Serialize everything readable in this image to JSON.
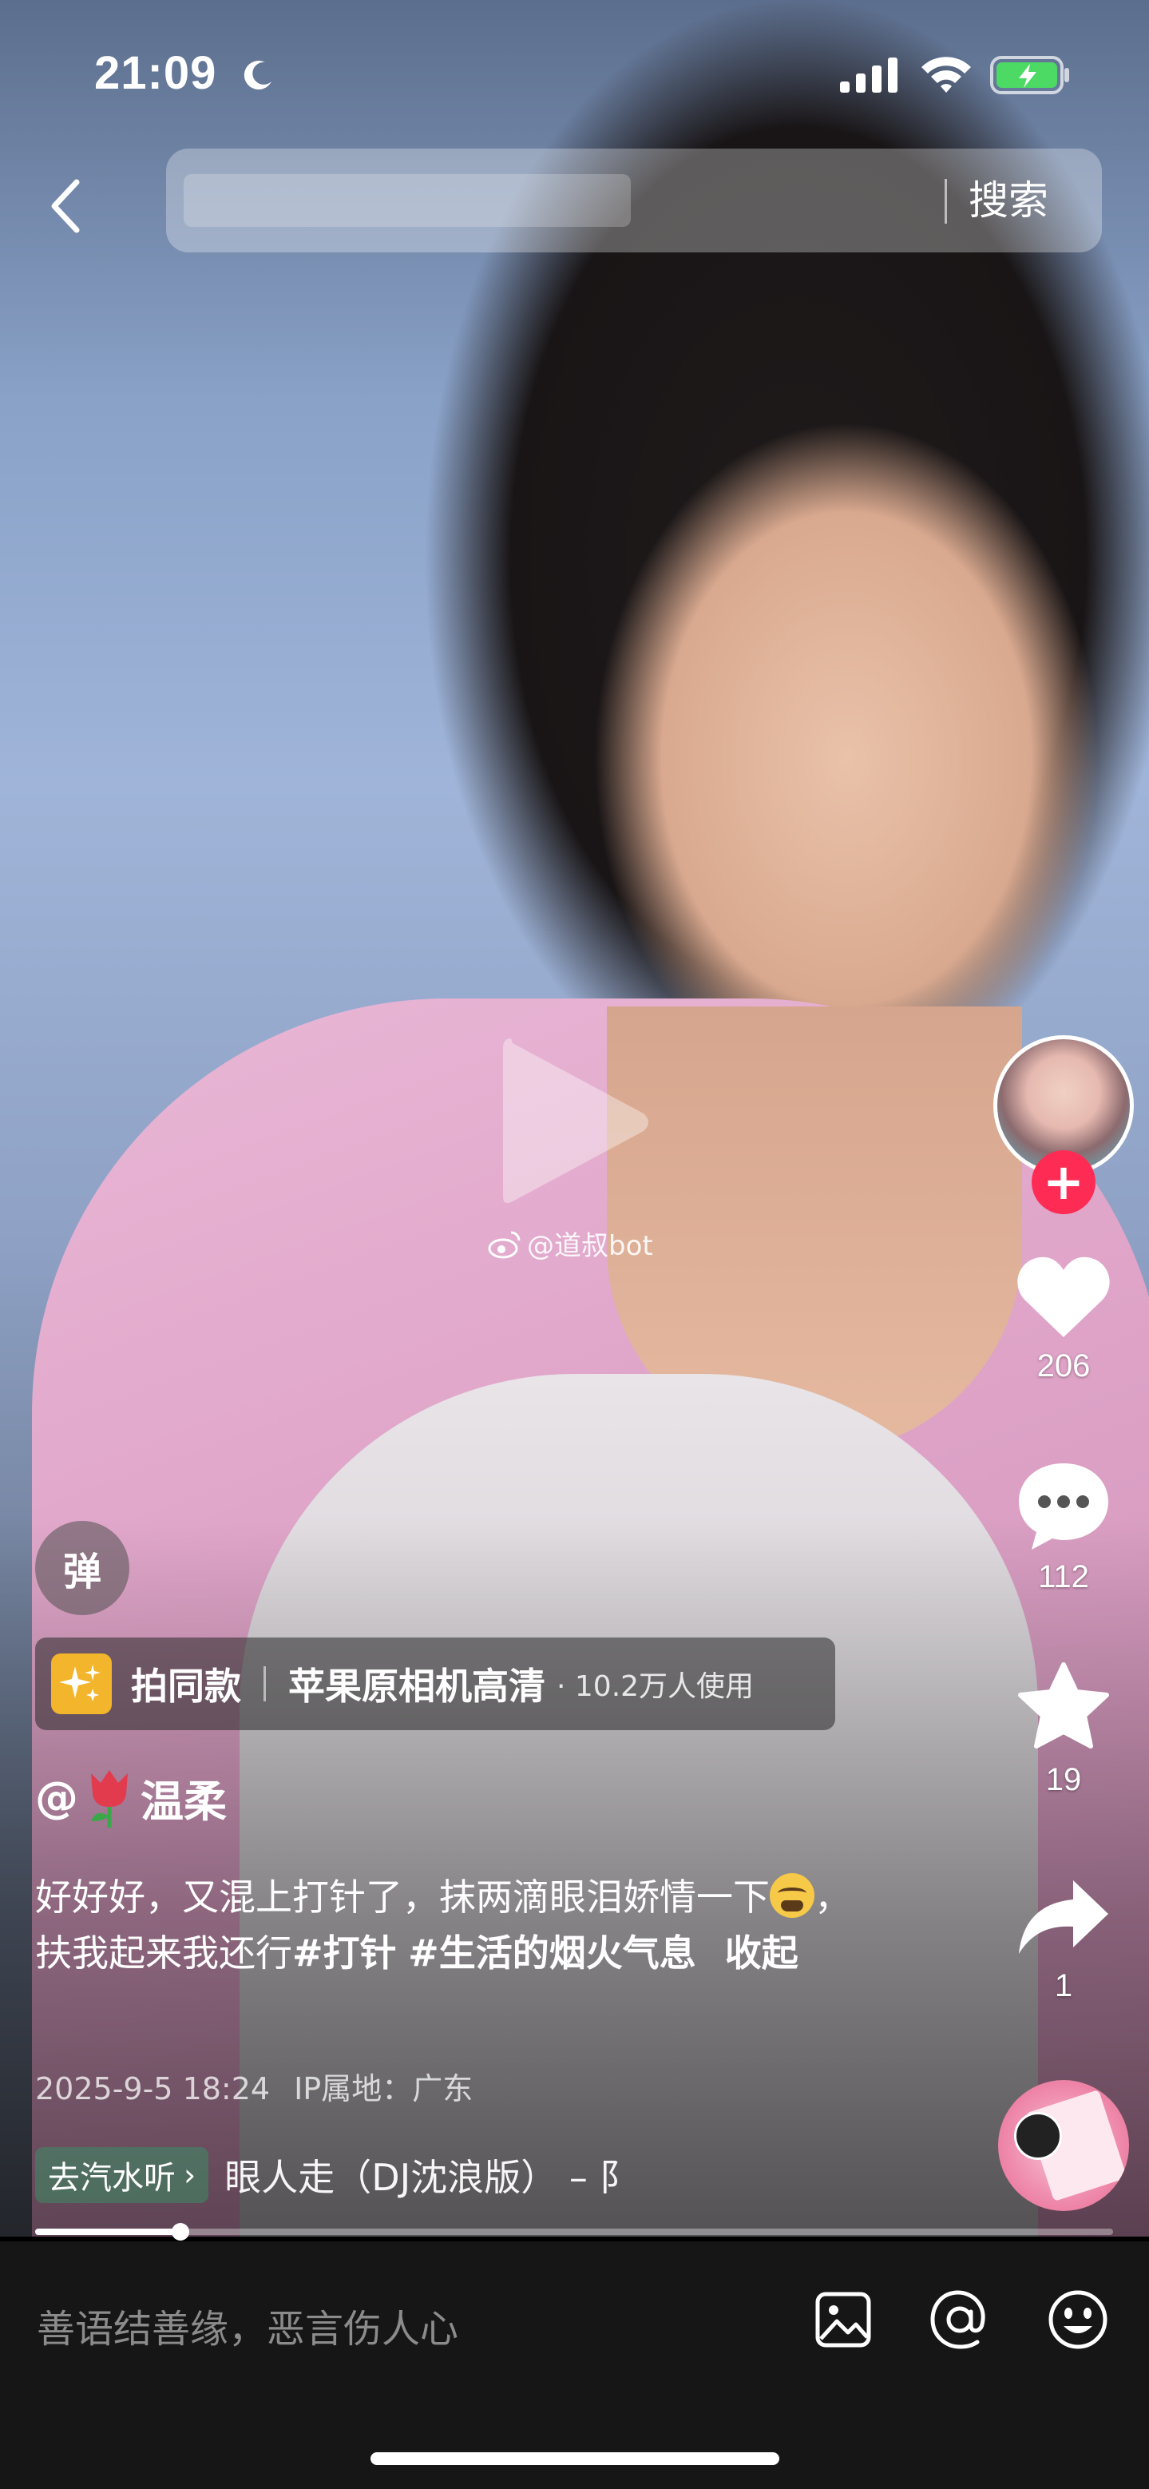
{
  "status_bar": {
    "time": "21:09"
  },
  "search": {
    "button_label": "搜索"
  },
  "watermark": {
    "text": "@道叔bot"
  },
  "actions": {
    "likes": "206",
    "comments": "112",
    "favorites": "19",
    "shares": "1",
    "follow_symbol": "+"
  },
  "danmaku": {
    "label": "弹"
  },
  "template": {
    "action": "拍同款",
    "name": "苹果原相机高清",
    "usage": "· 10.2万人使用"
  },
  "author": {
    "prefix": "@",
    "name": "温柔"
  },
  "caption": {
    "text_a": "好好好，又混上打针了，抹两滴眼泪娇情一下",
    "text_b": "，扶我起来我还行",
    "tag1": "#打针",
    "tag2": "#生活的烟火气息",
    "more": "收起"
  },
  "post": {
    "datetime": "2025-9-5 18:24",
    "ip_location": "IP属地：广东"
  },
  "music": {
    "listen_label": "去汽水听",
    "chevron": "›",
    "track": "眼人走（DJ沈浪版） – 阝"
  },
  "progress": {
    "fraction": 0.135
  },
  "comment_bar": {
    "placeholder": "善语结善缘，恶言伤人心"
  },
  "icons": [
    "back-icon",
    "moon-icon",
    "signal-icon",
    "wifi-icon",
    "battery-icon",
    "play-icon",
    "weibo-icon",
    "heart-icon",
    "comment-icon",
    "star-icon",
    "share-icon",
    "sparkle-icon",
    "tulip-icon",
    "image-icon",
    "at-icon",
    "emoji-icon"
  ],
  "colors": {
    "follow": "#fe2c55",
    "template_icon": "#f3b52b",
    "battery": "#4cd964"
  }
}
